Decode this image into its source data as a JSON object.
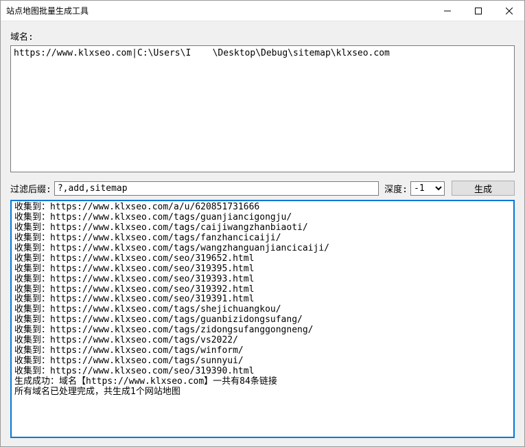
{
  "window": {
    "title": "站点地图批量生成工具"
  },
  "labels": {
    "domain": "域名:",
    "filter_suffix": "过滤后缀:",
    "depth": "深度:"
  },
  "inputs": {
    "domain_value": "https://www.klxseo.com|C:\\Users\\I    \\Desktop\\Debug\\sitemap\\klxseo.com",
    "filter_value": "?,add,sitemap",
    "depth_value": "-1"
  },
  "buttons": {
    "generate": "生成"
  },
  "log": {
    "lines": [
      "收集到：https://www.klxseo.com/a/u/620851731666",
      "收集到：https://www.klxseo.com/tags/guanjiancigongju/",
      "收集到：https://www.klxseo.com/tags/caijiwangzhanbiaoti/",
      "收集到：https://www.klxseo.com/tags/fanzhancicaiji/",
      "收集到：https://www.klxseo.com/tags/wangzhanguanjiancicaiji/",
      "收集到：https://www.klxseo.com/seo/319652.html",
      "收集到：https://www.klxseo.com/seo/319395.html",
      "收集到：https://www.klxseo.com/seo/319393.html",
      "收集到：https://www.klxseo.com/seo/319392.html",
      "收集到：https://www.klxseo.com/seo/319391.html",
      "收集到：https://www.klxseo.com/tags/shejichuangkou/",
      "收集到：https://www.klxseo.com/tags/guanbizidongsufang/",
      "收集到：https://www.klxseo.com/tags/zidongsufanggongneng/",
      "收集到：https://www.klxseo.com/tags/vs2022/",
      "收集到：https://www.klxseo.com/tags/winform/",
      "收集到：https://www.klxseo.com/tags/sunnyui/",
      "收集到：https://www.klxseo.com/seo/319390.html",
      "生成成功：域名【https://www.klxseo.com】一共有84条链接",
      "所有域名已处理完成，共生成1个网站地图"
    ]
  }
}
